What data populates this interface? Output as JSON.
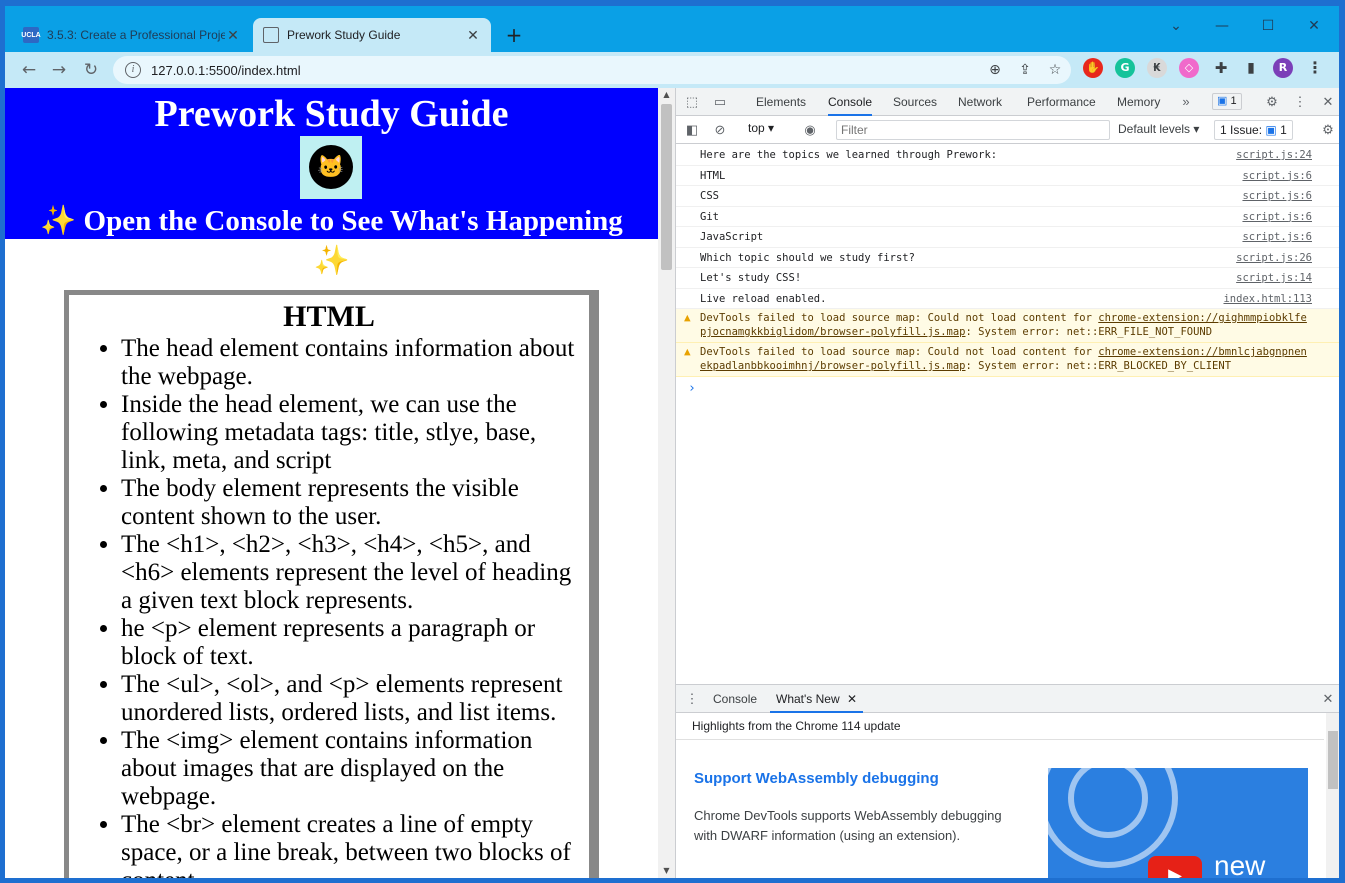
{
  "browser": {
    "tabs": [
      {
        "label": "3.5.3: Create a Professional Proje",
        "favicon": "UCLA",
        "active": false
      },
      {
        "label": "Prework Study Guide",
        "favicon": "globe-icon",
        "active": true
      }
    ],
    "url": "127.0.0.1:5500/index.html",
    "profile_initial": "R"
  },
  "page": {
    "title": "Prework Study Guide",
    "subtitle": "✨ Open the Console to See What's Happening",
    "subtitle_tail": "✨",
    "card": {
      "heading": "HTML",
      "items": [
        "The head element contains information about the webpage.",
        "Inside the head element, we can use the following metadata tags: title, stlye, base, link, meta, and script",
        "The body element represents the visible content shown to the user.",
        "The <h1>, <h2>, <h3>, <h4>, <h5>, and <h6> elements represent the level of heading a given text block represents.",
        "he <p> element represents a paragraph or block of text.",
        "The <ul>, <ol>, and <p> elements represent unordered lists, ordered lists, and list items.",
        "The <img> element contains information about images that are displayed on the webpage.",
        "The <br> element creates a line of empty space, or a line break, between two blocks of content."
      ]
    },
    "colors": {
      "header_bg": "#0000ff",
      "card_border": "#888888"
    }
  },
  "devtools": {
    "tabs": [
      "Elements",
      "Console",
      "Sources",
      "Network",
      "Performance",
      "Memory"
    ],
    "active_tab": "Console",
    "issues_badge": "1",
    "context": "top",
    "filter_placeholder": "Filter",
    "levels": "Default levels",
    "issues_label": "1 Issue:",
    "issues_count": "1",
    "logs": [
      {
        "text": "Here are the topics we learned through Prework:",
        "source": "script.js:24"
      },
      {
        "text": "HTML",
        "source": "script.js:6"
      },
      {
        "text": "CSS",
        "source": "script.js:6"
      },
      {
        "text": "Git",
        "source": "script.js:6"
      },
      {
        "text": "JavaScript",
        "source": "script.js:6"
      },
      {
        "text": "Which topic should we study first?",
        "source": "script.js:26"
      },
      {
        "text": "Let's study CSS!",
        "source": "script.js:14"
      },
      {
        "text": "Live reload enabled.",
        "source": "index.html:113"
      }
    ],
    "warnings": [
      {
        "prefix": "DevTools failed to load source map: Could not load content for ",
        "link": "chrome-extension://gighmmpiobklfepjocnamgkkbiglidom/browser-polyfill.js.map",
        "suffix": ": System error: net::ERR_FILE_NOT_FOUND"
      },
      {
        "prefix": "DevTools failed to load source map: Could not load content for ",
        "link": "chrome-extension://bmnlcjabgnpnenekpadlanbbkooimhnj/browser-polyfill.js.map",
        "suffix": ": System error: net::ERR_BLOCKED_BY_CLIENT"
      }
    ],
    "drawer": {
      "tabs": [
        "Console",
        "What's New"
      ],
      "active_tab": "What's New",
      "highlights": "Highlights from the Chrome 114 update",
      "news_title": "Support WebAssembly debugging",
      "news_body": "Chrome DevTools supports WebAssembly debugging with DWARF information (using an extension).",
      "thumb_label": "new"
    }
  }
}
